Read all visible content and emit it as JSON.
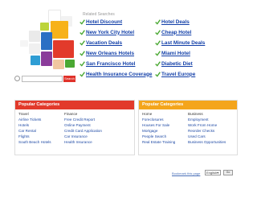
{
  "search": {
    "placeholder": "",
    "button_label": "Search"
  },
  "related": {
    "title": "Related Searches",
    "items": [
      {
        "label": "Hotel Discount"
      },
      {
        "label": "Hotel Deals"
      },
      {
        "label": "New York City Hotel"
      },
      {
        "label": "Cheap Hotel"
      },
      {
        "label": "Vacation Deals"
      },
      {
        "label": "Last Minute Deals"
      },
      {
        "label": "New Orleans Hotels"
      },
      {
        "label": "Miami Hotel"
      },
      {
        "label": "San Francisco Hotel"
      },
      {
        "label": "Diabetic Diet"
      },
      {
        "label": "Health Insurance Coverage"
      },
      {
        "label": "Travel Europe"
      }
    ]
  },
  "popular_left": {
    "title": "Popular Categories",
    "color": "#e23a2b",
    "columns": [
      {
        "head": "Travel",
        "links": [
          "Airline Tickets",
          "Hotels",
          "Car Rental",
          "Flights",
          "South Beach Hotels"
        ]
      },
      {
        "head": "Finance",
        "links": [
          "Free Credit Report",
          "Online Payment",
          "Credit Card Application",
          "Car Insurance",
          "Health Insurance"
        ]
      }
    ]
  },
  "popular_right": {
    "title": "Popular Categories",
    "color": "#f4a51c",
    "columns": [
      {
        "head": "Home",
        "links": [
          "Foreclosures",
          "Houses For Sale",
          "Mortgage",
          "People Search",
          "Real Estate Training"
        ]
      },
      {
        "head": "Business",
        "links": [
          "Employment",
          "Work From Home",
          "Reorder Checks",
          "Used Cars",
          "Business Opportunities"
        ]
      }
    ]
  },
  "footer": {
    "bookmark_label": "Bookmark this page",
    "language": "English",
    "submit_label": "Go"
  },
  "colors": {
    "link": "#123fa8",
    "check": "#4aa832"
  }
}
